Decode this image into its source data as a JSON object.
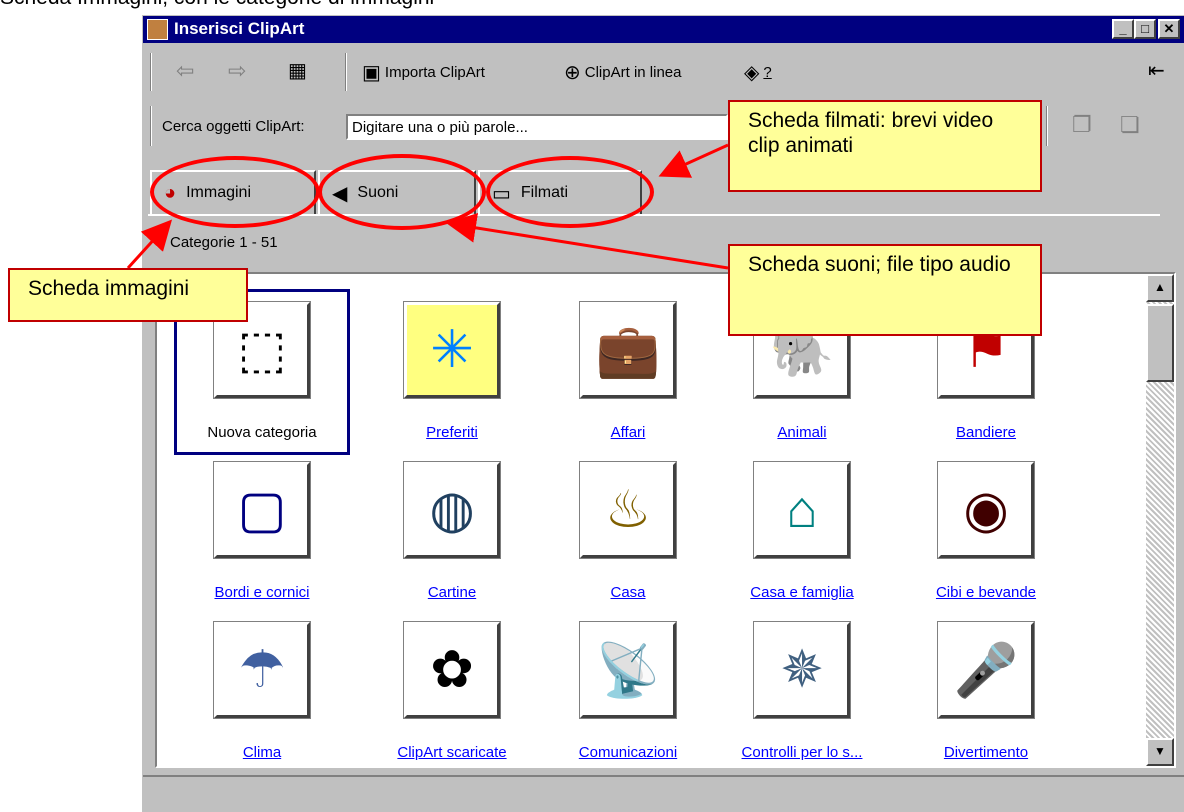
{
  "top_text": "Scheda Immagini, con le categorie di immagini",
  "window": {
    "title": "Inserisci ClipArt",
    "caption_buttons": [
      "minimize-icon",
      "maximize-icon",
      "close-icon"
    ]
  },
  "toolbar": {
    "import_label": "Importa ClipArt",
    "online_label": "ClipArt in linea",
    "help_label": "?"
  },
  "search": {
    "label": "Cerca oggetti ClipArt:",
    "placeholder": "Digitare una o più parole..."
  },
  "tabs": [
    {
      "label": "Immagini",
      "icon": "pictures-icon"
    },
    {
      "label": "Suoni",
      "icon": "speaker-icon"
    },
    {
      "label": "Filmati",
      "icon": "camera-icon"
    }
  ],
  "category_count": "Categorie 1 - 51",
  "categories": [
    {
      "label": "Nuova categoria"
    },
    {
      "label": "Preferiti"
    },
    {
      "label": "Affari"
    },
    {
      "label": "Animali"
    },
    {
      "label": "Bandiere"
    },
    {
      "label": "Bordi e cornici"
    },
    {
      "label": "Cartine"
    },
    {
      "label": "Casa"
    },
    {
      "label": "Casa e famiglia"
    },
    {
      "label": "Cibi e bevande"
    },
    {
      "label": "Clima"
    },
    {
      "label": "ClipArt scaricate"
    },
    {
      "label": "Comunicazioni"
    },
    {
      "label": "Controlli per lo s..."
    },
    {
      "label": "Divertimento"
    }
  ],
  "annotations": {
    "filmati": "Scheda filmati: brevi video clip animati",
    "suoni": "Scheda suoni; file tipo audio",
    "immagini": "Scheda immagini"
  },
  "colors": {
    "titlebar": "#000080",
    "annotation_bg": "#ffff99",
    "ellipse": "#ff0000"
  }
}
